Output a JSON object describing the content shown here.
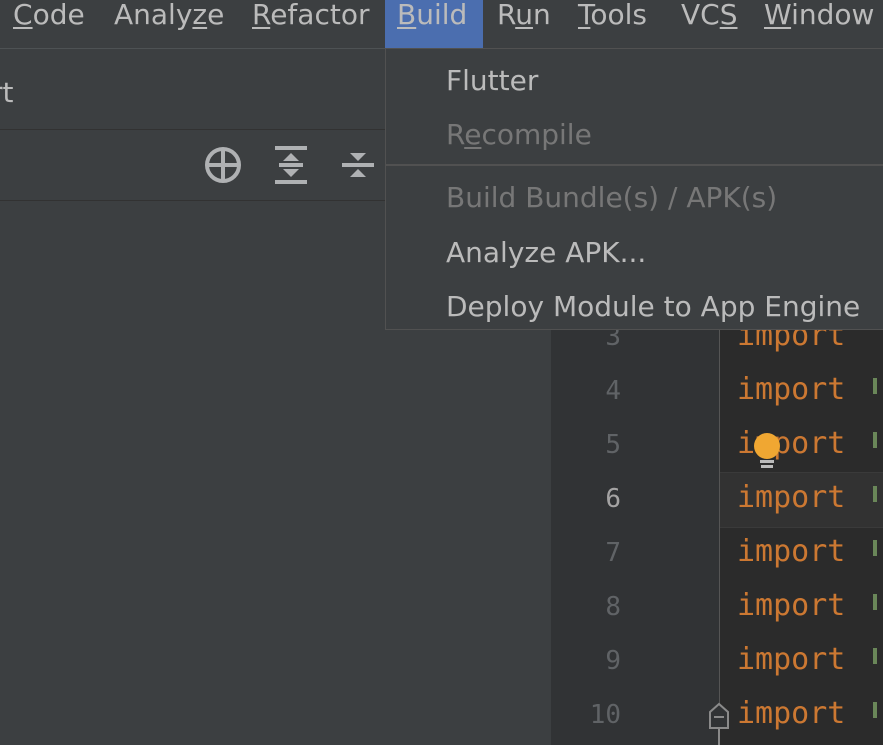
{
  "menubar": {
    "items": [
      {
        "pre": "",
        "mn": "C",
        "post": "ode"
      },
      {
        "pre": "Analy",
        "mn": "z",
        "post": "e"
      },
      {
        "pre": "",
        "mn": "R",
        "post": "efactor"
      },
      {
        "pre": "",
        "mn": "B",
        "post": "uild"
      },
      {
        "pre": "R",
        "mn": "u",
        "post": "n"
      },
      {
        "pre": "",
        "mn": "T",
        "post": "ools"
      },
      {
        "pre": "VC",
        "mn": "S",
        "post": ""
      },
      {
        "pre": "",
        "mn": "W",
        "post": "indow"
      }
    ],
    "active": "Build"
  },
  "project": {
    "title_fragment": "rt"
  },
  "toolbar": {
    "icons": [
      "locate-icon",
      "expand-all-icon",
      "collapse-all-icon"
    ]
  },
  "build_menu": {
    "items": [
      {
        "pre": "Flutter",
        "mn": "",
        "post": "",
        "enabled": true
      },
      {
        "pre": "R",
        "mn": "e",
        "post": "compile",
        "enabled": false
      },
      {
        "pre": "Build Bundle(s) / APK(s)",
        "mn": "",
        "post": "",
        "enabled": false
      },
      {
        "pre": "Analyze APK...",
        "mn": "",
        "post": "",
        "enabled": true
      },
      {
        "pre": "Deploy Module to App Engine",
        "mn": "",
        "post": "",
        "enabled": true
      }
    ]
  },
  "editor": {
    "lines": [
      {
        "num": "3",
        "code": "import"
      },
      {
        "num": "4",
        "code": "import"
      },
      {
        "num": "5",
        "code": "import"
      },
      {
        "num": "6",
        "code": "import"
      },
      {
        "num": "7",
        "code": "import"
      },
      {
        "num": "8",
        "code": "import"
      },
      {
        "num": "9",
        "code": "import"
      },
      {
        "num": "10",
        "code": "import"
      }
    ],
    "current_line": "6"
  },
  "colors": {
    "menu_active": "#4b6eaf",
    "keyword": "#cc7832",
    "string": "#6a8759",
    "bulb": "#f0a732"
  }
}
